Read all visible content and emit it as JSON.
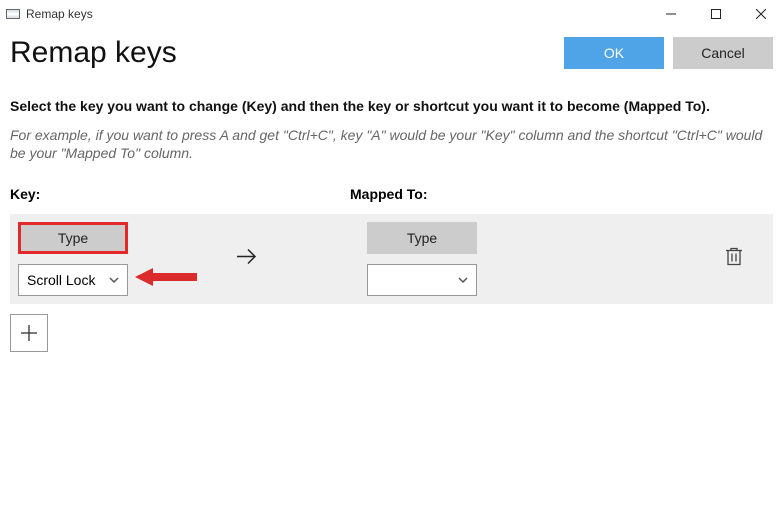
{
  "titlebar": {
    "title": "Remap keys"
  },
  "header": {
    "title": "Remap keys",
    "ok_label": "OK",
    "cancel_label": "Cancel"
  },
  "body": {
    "instruction": "Select the key you want to change (Key) and then the key or shortcut you want it to become (Mapped To).",
    "example": "For example, if you want to press A and get \"Ctrl+C\", key \"A\" would be your \"Key\" column and the shortcut \"Ctrl+C\" would be your \"Mapped To\" column.",
    "col_key_label": "Key:",
    "col_mapped_label": "Mapped To:"
  },
  "row": {
    "key_type_label": "Type",
    "key_select_value": "Scroll Lock",
    "mapped_type_label": "Type",
    "mapped_select_value": ""
  }
}
